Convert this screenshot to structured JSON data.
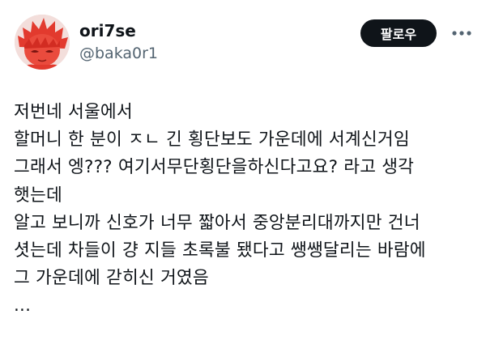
{
  "user": {
    "display_name": "ori7se",
    "handle": "@baka0r1"
  },
  "actions": {
    "follow_label": "팔로우",
    "more_icon": "more-horizontal-icon"
  },
  "post": {
    "lines": [
      "저번네 서울에서",
      "할머니 한 분이 ㅈㄴ 긴 횡단보도 가운데에 서계신거임",
      "그래서 엥??? 여기서무단횡단을하신다고요? 라고 생각",
      "햇는데",
      "알고 보니까 신호가 너무 짧아서 중앙분리대까지만 건너",
      "셧는데 차들이 걍 지들 초록불 됐다고 쌩쌩달리는 바람에",
      "그 가운데에 갇히신 거였음",
      "..."
    ]
  },
  "colors": {
    "text_primary": "#0f1419",
    "text_secondary": "#536471",
    "follow_button_bg": "#0f1419",
    "follow_button_text": "#ffffff",
    "avatar_accent": "#e23a2e"
  }
}
